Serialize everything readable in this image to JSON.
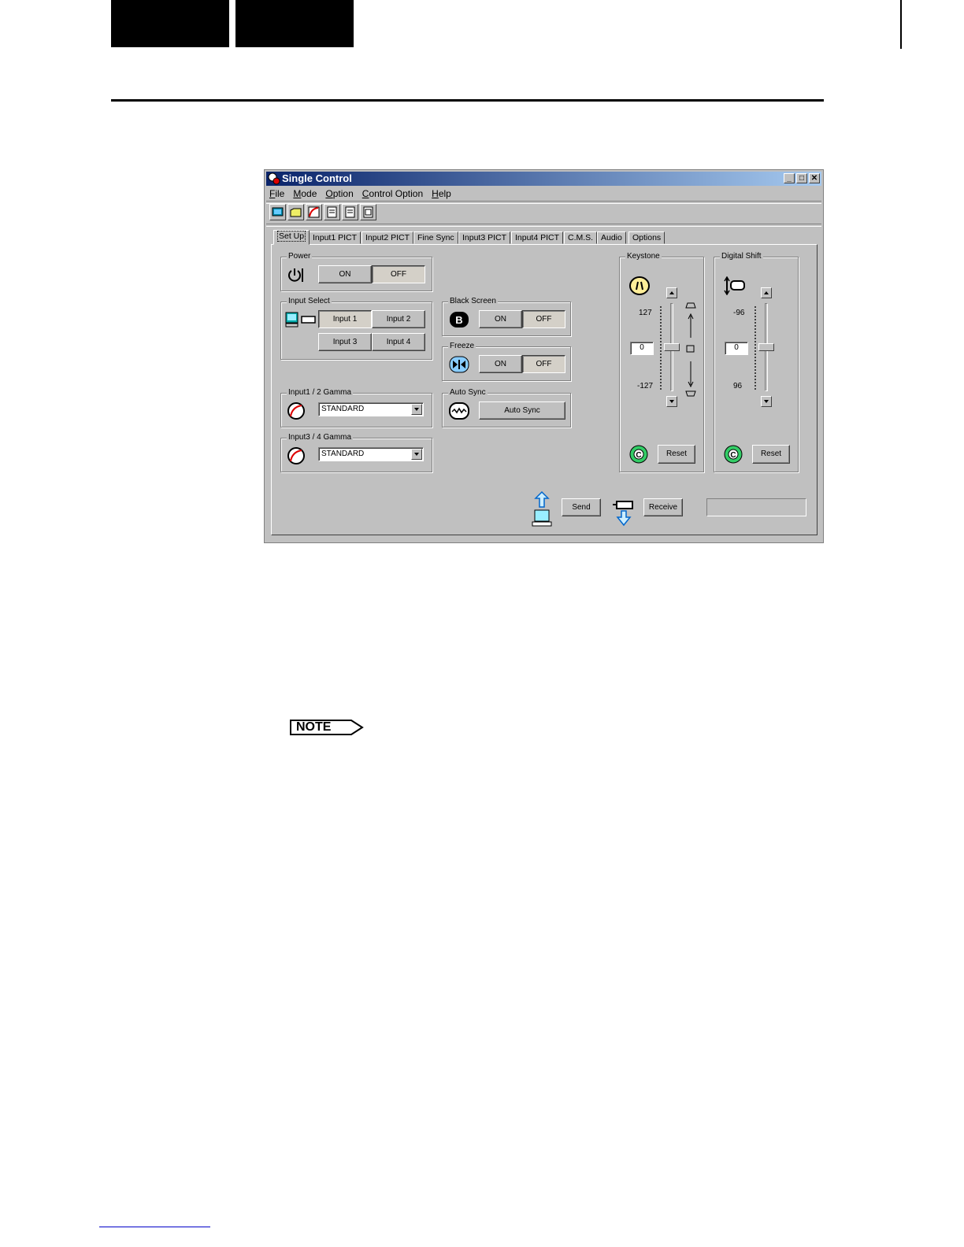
{
  "window": {
    "title": "Single Control",
    "menu": [
      "File",
      "Mode",
      "Option",
      "Control Option",
      "Help"
    ],
    "toolbar_icons": [
      "monitor-icon",
      "folder-icon",
      "gamma-icon",
      "doc-icon",
      "doc-icon",
      "doc-icon"
    ]
  },
  "tabs": [
    "Set Up",
    "Input1 PICT",
    "Input2 PICT",
    "Fine Sync",
    "Input3 PICT",
    "Input4 PICT",
    "C.M.S.",
    "Audio",
    "Options"
  ],
  "power": {
    "label": "Power",
    "on": "ON",
    "off": "OFF"
  },
  "input_select": {
    "label": "Input Select",
    "buttons": [
      "Input 1",
      "Input 2",
      "Input 3",
      "Input 4"
    ]
  },
  "gamma12": {
    "label": "Input1 / 2 Gamma",
    "value": "STANDARD"
  },
  "gamma34": {
    "label": "Input3 / 4 Gamma",
    "value": "STANDARD"
  },
  "black_screen": {
    "label": "Black Screen",
    "on": "ON",
    "off": "OFF"
  },
  "freeze": {
    "label": "Freeze",
    "on": "ON",
    "off": "OFF"
  },
  "auto_sync": {
    "label": "Auto Sync",
    "button": "Auto Sync"
  },
  "keystone": {
    "label": "Keystone",
    "max": "127",
    "value": "0",
    "min": "-127",
    "reset": "Reset"
  },
  "digital_shift": {
    "label": "Digital Shift",
    "max": "-96",
    "value": "0",
    "min": "96",
    "reset": "Reset"
  },
  "transfer": {
    "send": "Send",
    "receive": "Receive"
  },
  "note": {
    "label": "NOTE"
  }
}
